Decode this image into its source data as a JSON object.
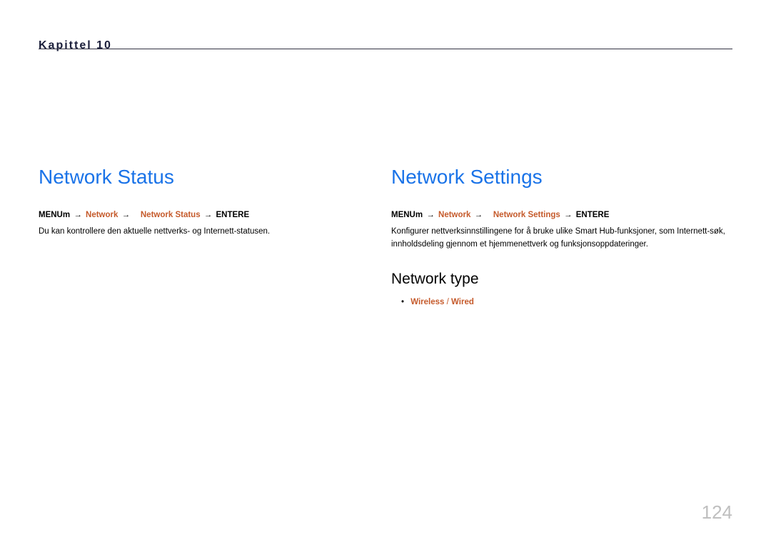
{
  "chapter_mark": "Kapittel 10",
  "left": {
    "heading": "Network Status",
    "crumb_menu": "MENU",
    "crumb_menu_suffix": "m",
    "crumb_arrow": "→",
    "crumb_network": "Network",
    "crumb_item": "Network Status",
    "crumb_enter": "ENTER",
    "crumb_enter_suffix": "E",
    "body": "Du kan kontrollere den aktuelle nettverks- og Internett-statusen."
  },
  "right": {
    "heading": "Network Settings",
    "crumb_menu": "MENU",
    "crumb_menu_suffix": "m",
    "crumb_arrow": "→",
    "crumb_network": "Network",
    "crumb_item": "Network Settings",
    "crumb_enter": "ENTER",
    "crumb_enter_suffix": "E",
    "body": "Konfigurer nettverksinnstillingene for å bruke ulike Smart Hub-funksjoner, som Internett-søk, innholdsdeling gjennom et hjemmenettverk og funksjonsoppdateringer.",
    "sub_heading": "Network type",
    "bullet_dot": "•",
    "option1": "Wireless",
    "option_sep": " / ",
    "option2": "Wired"
  },
  "page_number": "124"
}
